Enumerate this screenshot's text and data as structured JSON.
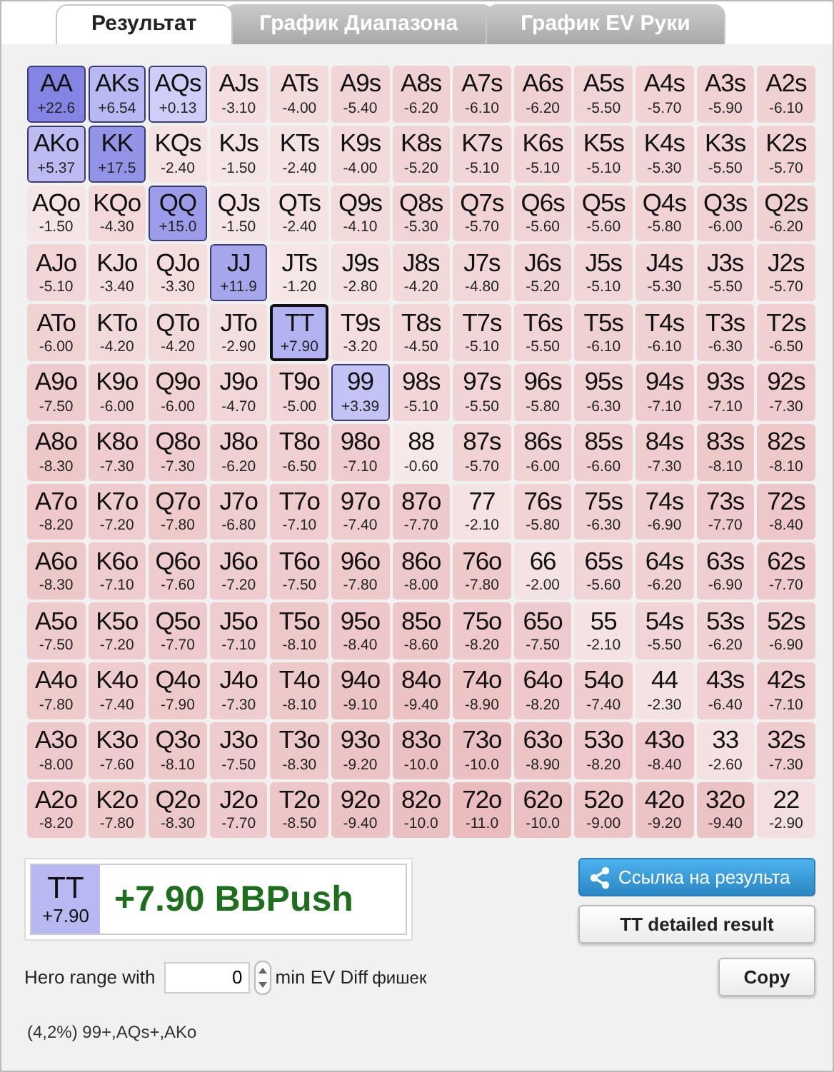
{
  "tabs": [
    {
      "label": "Результат",
      "selected": true
    },
    {
      "label": "График Диапазона",
      "selected": false
    },
    {
      "label": "График EV Руки",
      "selected": false
    }
  ],
  "grid": {
    "rows": [
      [
        {
          "hand": "AA",
          "ev": "+22.6",
          "selected": false
        },
        {
          "hand": "AKs",
          "ev": "+6.54",
          "selected": false
        },
        {
          "hand": "AQs",
          "ev": "+0.13",
          "selected": false
        },
        {
          "hand": "AJs",
          "ev": "-3.10",
          "selected": false
        },
        {
          "hand": "ATs",
          "ev": "-4.00",
          "selected": false
        },
        {
          "hand": "A9s",
          "ev": "-5.40",
          "selected": false
        },
        {
          "hand": "A8s",
          "ev": "-6.20",
          "selected": false
        },
        {
          "hand": "A7s",
          "ev": "-6.10",
          "selected": false
        },
        {
          "hand": "A6s",
          "ev": "-6.20",
          "selected": false
        },
        {
          "hand": "A5s",
          "ev": "-5.50",
          "selected": false
        },
        {
          "hand": "A4s",
          "ev": "-5.70",
          "selected": false
        },
        {
          "hand": "A3s",
          "ev": "-5.90",
          "selected": false
        },
        {
          "hand": "A2s",
          "ev": "-6.10",
          "selected": false
        }
      ],
      [
        {
          "hand": "AKo",
          "ev": "+5.37",
          "selected": false
        },
        {
          "hand": "KK",
          "ev": "+17.5",
          "selected": false
        },
        {
          "hand": "KQs",
          "ev": "-2.40",
          "selected": false
        },
        {
          "hand": "KJs",
          "ev": "-1.50",
          "selected": false
        },
        {
          "hand": "KTs",
          "ev": "-2.40",
          "selected": false
        },
        {
          "hand": "K9s",
          "ev": "-4.00",
          "selected": false
        },
        {
          "hand": "K8s",
          "ev": "-5.20",
          "selected": false
        },
        {
          "hand": "K7s",
          "ev": "-5.10",
          "selected": false
        },
        {
          "hand": "K6s",
          "ev": "-5.10",
          "selected": false
        },
        {
          "hand": "K5s",
          "ev": "-5.10",
          "selected": false
        },
        {
          "hand": "K4s",
          "ev": "-5.30",
          "selected": false
        },
        {
          "hand": "K3s",
          "ev": "-5.50",
          "selected": false
        },
        {
          "hand": "K2s",
          "ev": "-5.70",
          "selected": false
        }
      ],
      [
        {
          "hand": "AQo",
          "ev": "-1.50",
          "selected": false
        },
        {
          "hand": "KQo",
          "ev": "-4.30",
          "selected": false
        },
        {
          "hand": "QQ",
          "ev": "+15.0",
          "selected": false
        },
        {
          "hand": "QJs",
          "ev": "-1.50",
          "selected": false
        },
        {
          "hand": "QTs",
          "ev": "-2.40",
          "selected": false
        },
        {
          "hand": "Q9s",
          "ev": "-4.10",
          "selected": false
        },
        {
          "hand": "Q8s",
          "ev": "-5.30",
          "selected": false
        },
        {
          "hand": "Q7s",
          "ev": "-5.70",
          "selected": false
        },
        {
          "hand": "Q6s",
          "ev": "-5.60",
          "selected": false
        },
        {
          "hand": "Q5s",
          "ev": "-5.60",
          "selected": false
        },
        {
          "hand": "Q4s",
          "ev": "-5.80",
          "selected": false
        },
        {
          "hand": "Q3s",
          "ev": "-6.00",
          "selected": false
        },
        {
          "hand": "Q2s",
          "ev": "-6.20",
          "selected": false
        }
      ],
      [
        {
          "hand": "AJo",
          "ev": "-5.10",
          "selected": false
        },
        {
          "hand": "KJo",
          "ev": "-3.40",
          "selected": false
        },
        {
          "hand": "QJo",
          "ev": "-3.30",
          "selected": false
        },
        {
          "hand": "JJ",
          "ev": "+11.9",
          "selected": false
        },
        {
          "hand": "JTs",
          "ev": "-1.20",
          "selected": false
        },
        {
          "hand": "J9s",
          "ev": "-2.80",
          "selected": false
        },
        {
          "hand": "J8s",
          "ev": "-4.20",
          "selected": false
        },
        {
          "hand": "J7s",
          "ev": "-4.80",
          "selected": false
        },
        {
          "hand": "J6s",
          "ev": "-5.20",
          "selected": false
        },
        {
          "hand": "J5s",
          "ev": "-5.10",
          "selected": false
        },
        {
          "hand": "J4s",
          "ev": "-5.30",
          "selected": false
        },
        {
          "hand": "J3s",
          "ev": "-5.50",
          "selected": false
        },
        {
          "hand": "J2s",
          "ev": "-5.70",
          "selected": false
        }
      ],
      [
        {
          "hand": "ATo",
          "ev": "-6.00",
          "selected": false
        },
        {
          "hand": "KTo",
          "ev": "-4.20",
          "selected": false
        },
        {
          "hand": "QTo",
          "ev": "-4.20",
          "selected": false
        },
        {
          "hand": "JTo",
          "ev": "-2.90",
          "selected": false
        },
        {
          "hand": "TT",
          "ev": "+7.90",
          "selected": true
        },
        {
          "hand": "T9s",
          "ev": "-3.20",
          "selected": false
        },
        {
          "hand": "T8s",
          "ev": "-4.50",
          "selected": false
        },
        {
          "hand": "T7s",
          "ev": "-5.10",
          "selected": false
        },
        {
          "hand": "T6s",
          "ev": "-5.50",
          "selected": false
        },
        {
          "hand": "T5s",
          "ev": "-6.10",
          "selected": false
        },
        {
          "hand": "T4s",
          "ev": "-6.10",
          "selected": false
        },
        {
          "hand": "T3s",
          "ev": "-6.30",
          "selected": false
        },
        {
          "hand": "T2s",
          "ev": "-6.50",
          "selected": false
        }
      ],
      [
        {
          "hand": "A9o",
          "ev": "-7.50",
          "selected": false
        },
        {
          "hand": "K9o",
          "ev": "-6.00",
          "selected": false
        },
        {
          "hand": "Q9o",
          "ev": "-6.00",
          "selected": false
        },
        {
          "hand": "J9o",
          "ev": "-4.70",
          "selected": false
        },
        {
          "hand": "T9o",
          "ev": "-5.00",
          "selected": false
        },
        {
          "hand": "99",
          "ev": "+3.39",
          "selected": false
        },
        {
          "hand": "98s",
          "ev": "-5.10",
          "selected": false
        },
        {
          "hand": "97s",
          "ev": "-5.50",
          "selected": false
        },
        {
          "hand": "96s",
          "ev": "-5.80",
          "selected": false
        },
        {
          "hand": "95s",
          "ev": "-6.30",
          "selected": false
        },
        {
          "hand": "94s",
          "ev": "-7.10",
          "selected": false
        },
        {
          "hand": "93s",
          "ev": "-7.10",
          "selected": false
        },
        {
          "hand": "92s",
          "ev": "-7.30",
          "selected": false
        }
      ],
      [
        {
          "hand": "A8o",
          "ev": "-8.30",
          "selected": false
        },
        {
          "hand": "K8o",
          "ev": "-7.30",
          "selected": false
        },
        {
          "hand": "Q8o",
          "ev": "-7.30",
          "selected": false
        },
        {
          "hand": "J8o",
          "ev": "-6.20",
          "selected": false
        },
        {
          "hand": "T8o",
          "ev": "-6.50",
          "selected": false
        },
        {
          "hand": "98o",
          "ev": "-7.10",
          "selected": false
        },
        {
          "hand": "88",
          "ev": "-0.60",
          "selected": false
        },
        {
          "hand": "87s",
          "ev": "-5.70",
          "selected": false
        },
        {
          "hand": "86s",
          "ev": "-6.00",
          "selected": false
        },
        {
          "hand": "85s",
          "ev": "-6.60",
          "selected": false
        },
        {
          "hand": "84s",
          "ev": "-7.30",
          "selected": false
        },
        {
          "hand": "83s",
          "ev": "-8.10",
          "selected": false
        },
        {
          "hand": "82s",
          "ev": "-8.10",
          "selected": false
        }
      ],
      [
        {
          "hand": "A7o",
          "ev": "-8.20",
          "selected": false
        },
        {
          "hand": "K7o",
          "ev": "-7.20",
          "selected": false
        },
        {
          "hand": "Q7o",
          "ev": "-7.80",
          "selected": false
        },
        {
          "hand": "J7o",
          "ev": "-6.80",
          "selected": false
        },
        {
          "hand": "T7o",
          "ev": "-7.10",
          "selected": false
        },
        {
          "hand": "97o",
          "ev": "-7.40",
          "selected": false
        },
        {
          "hand": "87o",
          "ev": "-7.70",
          "selected": false
        },
        {
          "hand": "77",
          "ev": "-2.10",
          "selected": false
        },
        {
          "hand": "76s",
          "ev": "-5.80",
          "selected": false
        },
        {
          "hand": "75s",
          "ev": "-6.30",
          "selected": false
        },
        {
          "hand": "74s",
          "ev": "-6.90",
          "selected": false
        },
        {
          "hand": "73s",
          "ev": "-7.70",
          "selected": false
        },
        {
          "hand": "72s",
          "ev": "-8.40",
          "selected": false
        }
      ],
      [
        {
          "hand": "A6o",
          "ev": "-8.30",
          "selected": false
        },
        {
          "hand": "K6o",
          "ev": "-7.10",
          "selected": false
        },
        {
          "hand": "Q6o",
          "ev": "-7.60",
          "selected": false
        },
        {
          "hand": "J6o",
          "ev": "-7.20",
          "selected": false
        },
        {
          "hand": "T6o",
          "ev": "-7.50",
          "selected": false
        },
        {
          "hand": "96o",
          "ev": "-7.80",
          "selected": false
        },
        {
          "hand": "86o",
          "ev": "-8.00",
          "selected": false
        },
        {
          "hand": "76o",
          "ev": "-7.80",
          "selected": false
        },
        {
          "hand": "66",
          "ev": "-2.00",
          "selected": false
        },
        {
          "hand": "65s",
          "ev": "-5.60",
          "selected": false
        },
        {
          "hand": "64s",
          "ev": "-6.20",
          "selected": false
        },
        {
          "hand": "63s",
          "ev": "-6.90",
          "selected": false
        },
        {
          "hand": "62s",
          "ev": "-7.70",
          "selected": false
        }
      ],
      [
        {
          "hand": "A5o",
          "ev": "-7.50",
          "selected": false
        },
        {
          "hand": "K5o",
          "ev": "-7.20",
          "selected": false
        },
        {
          "hand": "Q5o",
          "ev": "-7.70",
          "selected": false
        },
        {
          "hand": "J5o",
          "ev": "-7.10",
          "selected": false
        },
        {
          "hand": "T5o",
          "ev": "-8.10",
          "selected": false
        },
        {
          "hand": "95o",
          "ev": "-8.40",
          "selected": false
        },
        {
          "hand": "85o",
          "ev": "-8.60",
          "selected": false
        },
        {
          "hand": "75o",
          "ev": "-8.20",
          "selected": false
        },
        {
          "hand": "65o",
          "ev": "-7.50",
          "selected": false
        },
        {
          "hand": "55",
          "ev": "-2.10",
          "selected": false
        },
        {
          "hand": "54s",
          "ev": "-5.50",
          "selected": false
        },
        {
          "hand": "53s",
          "ev": "-6.20",
          "selected": false
        },
        {
          "hand": "52s",
          "ev": "-6.90",
          "selected": false
        }
      ],
      [
        {
          "hand": "A4o",
          "ev": "-7.80",
          "selected": false
        },
        {
          "hand": "K4o",
          "ev": "-7.40",
          "selected": false
        },
        {
          "hand": "Q4o",
          "ev": "-7.90",
          "selected": false
        },
        {
          "hand": "J4o",
          "ev": "-7.30",
          "selected": false
        },
        {
          "hand": "T4o",
          "ev": "-8.10",
          "selected": false
        },
        {
          "hand": "94o",
          "ev": "-9.10",
          "selected": false
        },
        {
          "hand": "84o",
          "ev": "-9.40",
          "selected": false
        },
        {
          "hand": "74o",
          "ev": "-8.90",
          "selected": false
        },
        {
          "hand": "64o",
          "ev": "-8.20",
          "selected": false
        },
        {
          "hand": "54o",
          "ev": "-7.40",
          "selected": false
        },
        {
          "hand": "44",
          "ev": "-2.30",
          "selected": false
        },
        {
          "hand": "43s",
          "ev": "-6.40",
          "selected": false
        },
        {
          "hand": "42s",
          "ev": "-7.10",
          "selected": false
        }
      ],
      [
        {
          "hand": "A3o",
          "ev": "-8.00",
          "selected": false
        },
        {
          "hand": "K3o",
          "ev": "-7.60",
          "selected": false
        },
        {
          "hand": "Q3o",
          "ev": "-8.10",
          "selected": false
        },
        {
          "hand": "J3o",
          "ev": "-7.50",
          "selected": false
        },
        {
          "hand": "T3o",
          "ev": "-8.30",
          "selected": false
        },
        {
          "hand": "93o",
          "ev": "-9.20",
          "selected": false
        },
        {
          "hand": "83o",
          "ev": "-10.0",
          "selected": false
        },
        {
          "hand": "73o",
          "ev": "-10.0",
          "selected": false
        },
        {
          "hand": "63o",
          "ev": "-8.90",
          "selected": false
        },
        {
          "hand": "53o",
          "ev": "-8.20",
          "selected": false
        },
        {
          "hand": "43o",
          "ev": "-8.40",
          "selected": false
        },
        {
          "hand": "33",
          "ev": "-2.60",
          "selected": false
        },
        {
          "hand": "32s",
          "ev": "-7.30",
          "selected": false
        }
      ],
      [
        {
          "hand": "A2o",
          "ev": "-8.20",
          "selected": false
        },
        {
          "hand": "K2o",
          "ev": "-7.80",
          "selected": false
        },
        {
          "hand": "Q2o",
          "ev": "-8.30",
          "selected": false
        },
        {
          "hand": "J2o",
          "ev": "-7.70",
          "selected": false
        },
        {
          "hand": "T2o",
          "ev": "-8.50",
          "selected": false
        },
        {
          "hand": "92o",
          "ev": "-9.40",
          "selected": false
        },
        {
          "hand": "82o",
          "ev": "-10.0",
          "selected": false
        },
        {
          "hand": "72o",
          "ev": "-11.0",
          "selected": false
        },
        {
          "hand": "62o",
          "ev": "-10.0",
          "selected": false
        },
        {
          "hand": "52o",
          "ev": "-9.00",
          "selected": false
        },
        {
          "hand": "42o",
          "ev": "-9.20",
          "selected": false
        },
        {
          "hand": "32o",
          "ev": "-9.40",
          "selected": false
        },
        {
          "hand": "22",
          "ev": "-2.90",
          "selected": false
        }
      ]
    ]
  },
  "result": {
    "hand": "TT",
    "ev": "+7.90",
    "summary": "+7.90 BBPush"
  },
  "share_button": "Ссылка на результа",
  "detail_button": "TT detailed result",
  "filter": {
    "label": "Hero range with",
    "value": "0",
    "suffix": "min EV Diff",
    "unit": "фишек"
  },
  "copy_button": "Copy",
  "range_text": "(4,2%) 99+,AQs+,AKo"
}
